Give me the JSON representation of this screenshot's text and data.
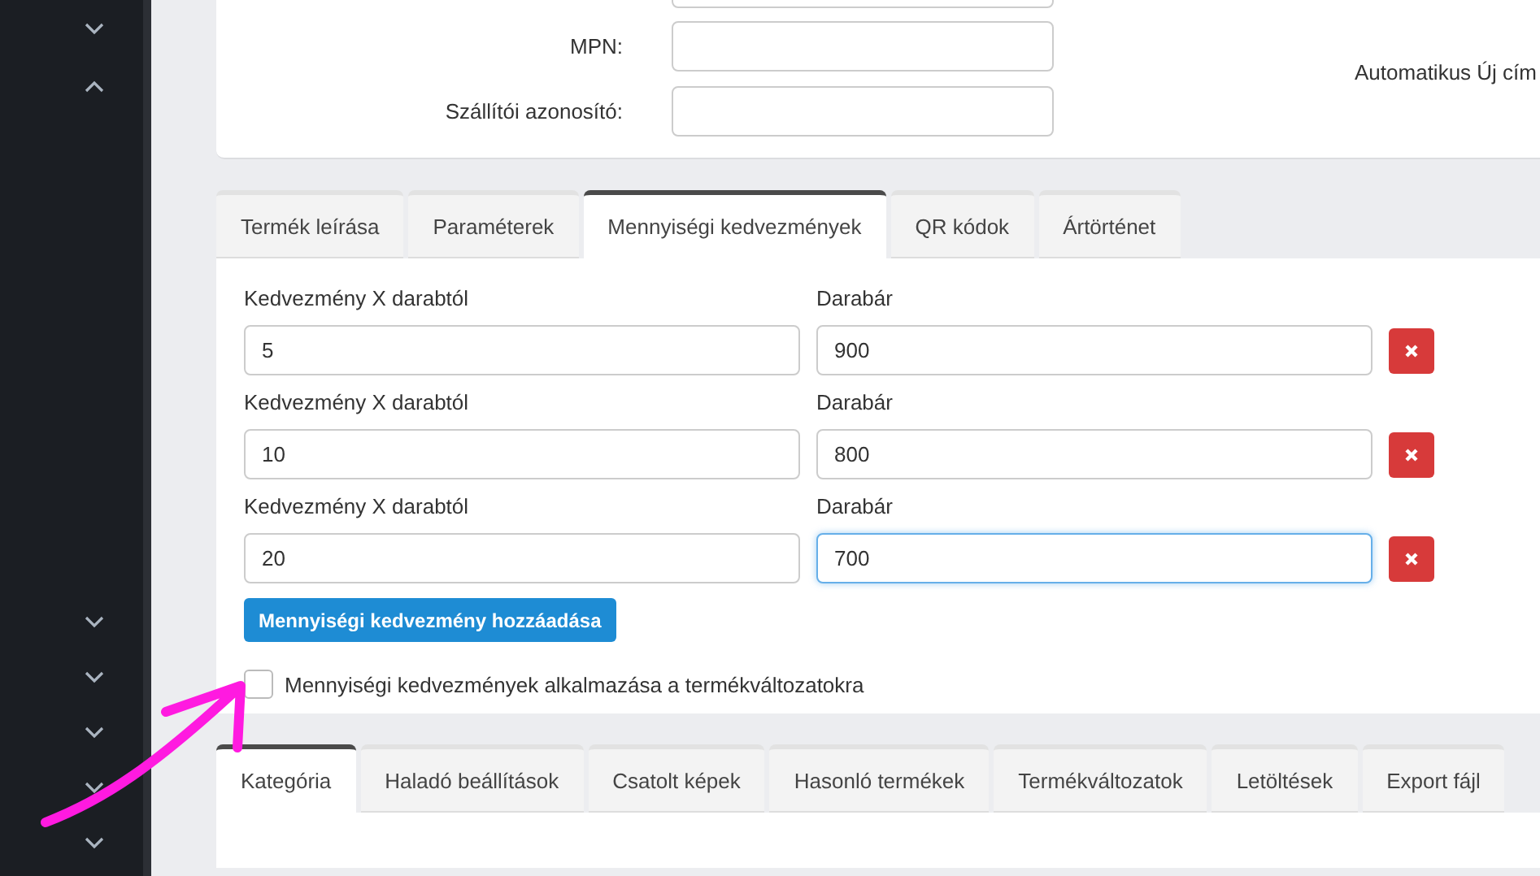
{
  "sidebar": {
    "items": [
      {
        "expanded": false
      },
      {
        "expanded": true
      },
      {
        "expanded": false
      },
      {
        "expanded": false
      },
      {
        "expanded": false
      },
      {
        "expanded": false
      },
      {
        "expanded": false
      }
    ]
  },
  "top_form": {
    "fields": [
      {
        "label": "MPN:"
      },
      {
        "label": "Szállítói azonosító:"
      }
    ],
    "right_label": "Automatikus Új cím"
  },
  "tabs": [
    {
      "label": "Termék leírása",
      "selected": false
    },
    {
      "label": "Paraméterek",
      "selected": false
    },
    {
      "label": "Mennyiségi kedvezmények",
      "selected": true
    },
    {
      "label": "QR kódok",
      "selected": false
    },
    {
      "label": "Ártörténet",
      "selected": false
    }
  ],
  "discounts": [
    {
      "qty_label": "Kedvezmény X darabtól",
      "qty": "5",
      "price_label": "Darabár",
      "price": "900",
      "focused": false
    },
    {
      "qty_label": "Kedvezmény X darabtól",
      "qty": "10",
      "price_label": "Darabár",
      "price": "800",
      "focused": false
    },
    {
      "qty_label": "Kedvezmény X darabtól",
      "qty": "20",
      "price_label": "Darabár",
      "price": "700",
      "focused": true
    }
  ],
  "add_button": "Mennyiségi kedvezmény hozzáadása",
  "apply_checkbox": {
    "label": "Mennyiségi kedvezmények alkalmazása a termékváltozatokra",
    "checked": false
  },
  "bottom_tabs": [
    {
      "label": "Kategória",
      "selected": true
    },
    {
      "label": "Haladó beállítások",
      "selected": false
    },
    {
      "label": "Csatolt képek",
      "selected": false
    },
    {
      "label": "Hasonló termékek",
      "selected": false
    },
    {
      "label": "Termékváltozatok",
      "selected": false
    },
    {
      "label": "Letöltések",
      "selected": false
    },
    {
      "label": "Export fájl",
      "selected": false
    }
  ]
}
